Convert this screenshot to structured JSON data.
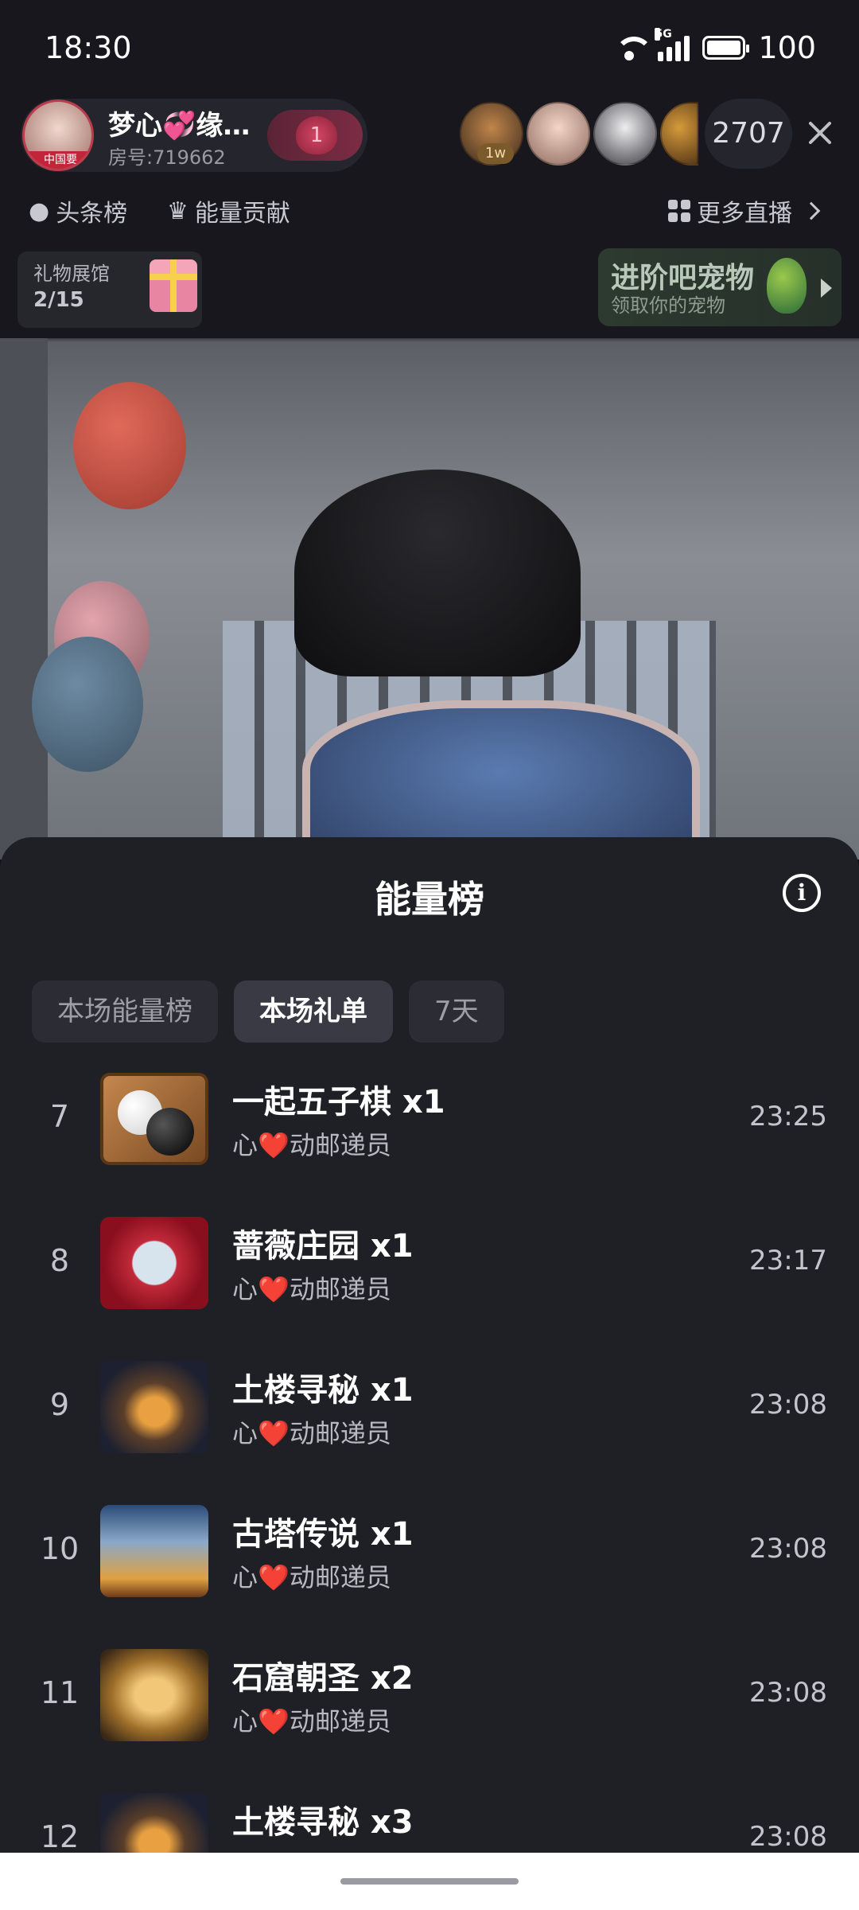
{
  "status_bar": {
    "time": "18:30",
    "network": "5G",
    "battery": "100"
  },
  "live_header": {
    "anchor_name": "梦心💞缘…",
    "anchor_tag": "中国要",
    "room_id": "房号:719662",
    "follow_badge_count": "1",
    "viewer_badge": "1w",
    "viewer_count": "2707",
    "chips": {
      "toutiao": "头条榜",
      "energy": "能量贡献",
      "more_live": "更多直播"
    },
    "gift_hall": {
      "title": "礼物展馆",
      "count": "2/15"
    },
    "pet_banner": {
      "title": "进阶吧宠物",
      "subtitle": "领取你的宠物"
    }
  },
  "sheet": {
    "title": "能量榜",
    "info_icon": "info-icon",
    "tabs": [
      {
        "label": "本场能量榜",
        "active": false
      },
      {
        "label": "本场礼单",
        "active": true
      },
      {
        "label": "7天",
        "active": false
      }
    ],
    "rows": [
      {
        "rank": "7",
        "gift": "一起五子棋  x1",
        "sender": "心❤️动邮递员",
        "time": "23:25"
      },
      {
        "rank": "8",
        "gift": "蔷薇庄园  x1",
        "sender": "心❤️动邮递员",
        "time": "23:17"
      },
      {
        "rank": "9",
        "gift": "土楼寻秘  x1",
        "sender": "心❤️动邮递员",
        "time": "23:08"
      },
      {
        "rank": "10",
        "gift": "古塔传说  x1",
        "sender": "心❤️动邮递员",
        "time": "23:08"
      },
      {
        "rank": "11",
        "gift": "石窟朝圣  x2",
        "sender": "心❤️动邮递员",
        "time": "23:08"
      },
      {
        "rank": "12",
        "gift": "土楼寻秘  x3",
        "sender": "",
        "time": "23:08"
      }
    ]
  }
}
